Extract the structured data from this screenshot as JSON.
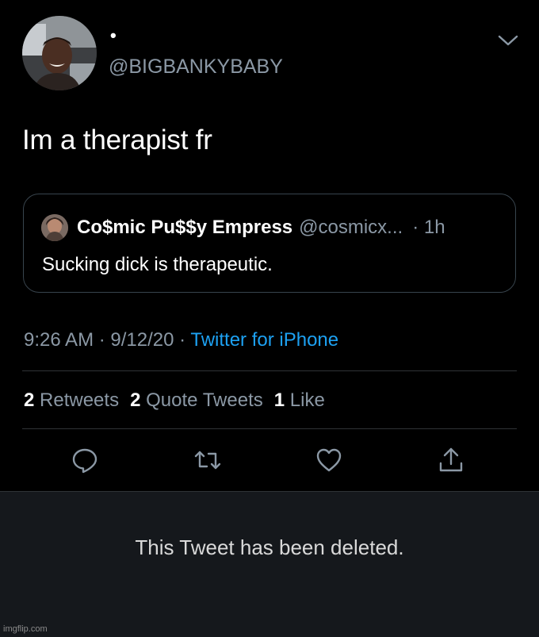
{
  "tweet": {
    "display_name": "•",
    "handle": "@BIGBANKYBABY",
    "text": "Im a therapist fr",
    "timestamp": "9:26 AM",
    "date_sep": " · ",
    "date": "9/12/20",
    "source_sep": " · ",
    "source": "Twitter for iPhone"
  },
  "quoted_tweet": {
    "name": "Co$mic Pu$$y Empress",
    "handle": "@cosmicx...",
    "sep": "·",
    "time": "1h",
    "text": "Sucking dick is therapeutic."
  },
  "stats": {
    "retweets_count": "2",
    "retweets_label": "Retweets",
    "quotes_count": "2",
    "quotes_label": "Quote Tweets",
    "likes_count": "1",
    "likes_label": "Like"
  },
  "actions": {
    "reply_icon": "reply-icon",
    "retweet_icon": "retweet-icon",
    "like_icon": "heart-icon",
    "share_icon": "share-icon"
  },
  "deleted": {
    "message": "This Tweet has been deleted."
  },
  "watermark": "imgflip.com",
  "colors": {
    "background": "#000000",
    "secondary_text": "#8b98a5",
    "link": "#1da1f2",
    "border": "#38444d",
    "deleted_panel": "#15181c"
  }
}
